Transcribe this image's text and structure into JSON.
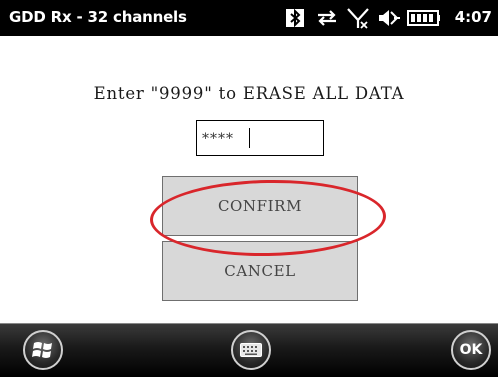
{
  "title_bar": {
    "app_title": "GDD Rx - 32 channels",
    "time": "4:07",
    "status_icons": [
      "bluetooth-icon",
      "sync-icon",
      "no-signal-icon",
      "speaker-icon",
      "battery-icon"
    ]
  },
  "dialog": {
    "prompt": "Enter \"9999\" to ERASE ALL DATA",
    "code_input_value": "****",
    "confirm_label": "CONFIRM",
    "cancel_label": "CANCEL",
    "highlight_color": "#d9262b"
  },
  "softkeys": {
    "left_icon": "windows-start-icon",
    "center_icon": "keyboard-icon",
    "right_label": "OK"
  }
}
